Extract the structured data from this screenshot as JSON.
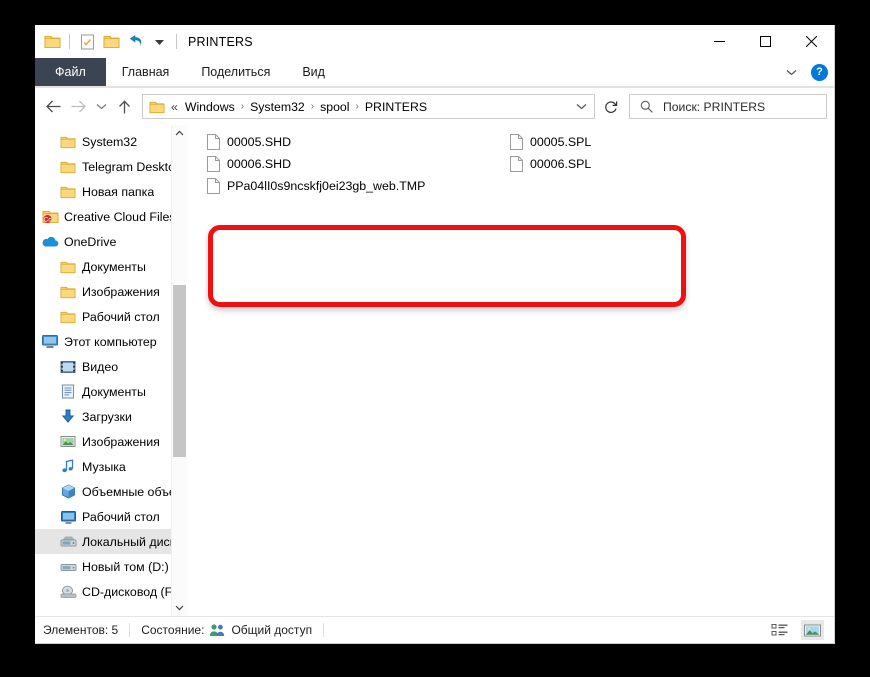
{
  "window": {
    "title": "PRINTERS",
    "quick_access": [
      {
        "name": "folder-icon",
        "label": "Папка"
      },
      {
        "name": "properties-icon",
        "label": "Свойства"
      },
      {
        "name": "new-folder-icon",
        "label": "Создать папку"
      },
      {
        "name": "undo-icon",
        "label": "Отменить"
      },
      {
        "name": "customize-dropdown-icon",
        "label": "Настроить панель быстрого доступа"
      }
    ],
    "controls": {
      "minimize": "—",
      "maximize": "☐",
      "close": "✕"
    }
  },
  "ribbon": {
    "tabs": [
      {
        "label": "Файл",
        "active": true
      },
      {
        "label": "Главная",
        "active": false
      },
      {
        "label": "Поделиться",
        "active": false
      },
      {
        "label": "Вид",
        "active": false
      }
    ],
    "expand_label": "⌄",
    "help_label": "?"
  },
  "navigation": {
    "back_label": "←",
    "forward_label": "→",
    "recent_label": "⌄",
    "up_label": "↑",
    "refresh_label": "↻",
    "dropdown_label": "⌄"
  },
  "address": {
    "prefix": "«",
    "crumbs": [
      "Windows",
      "System32",
      "spool",
      "PRINTERS"
    ],
    "separator": "›"
  },
  "search": {
    "placeholder": "Поиск: PRINTERS",
    "value": "Поиск: PRINTERS",
    "icon": "search-icon"
  },
  "sidebar": {
    "items": [
      {
        "label": "System32",
        "icon": "folder-icon",
        "indent": 1,
        "selected": false
      },
      {
        "label": "Telegram Desktop",
        "icon": "folder-icon",
        "indent": 1,
        "selected": false
      },
      {
        "label": "Новая папка",
        "icon": "folder-icon",
        "indent": 1,
        "selected": false
      },
      {
        "label": "Creative Cloud Files",
        "icon": "creative-cloud-icon",
        "indent": 0,
        "selected": false
      },
      {
        "label": "OneDrive",
        "icon": "onedrive-cloud-icon",
        "indent": 0,
        "selected": false
      },
      {
        "label": "Документы",
        "icon": "folder-icon",
        "indent": 1,
        "selected": false
      },
      {
        "label": "Изображения",
        "icon": "folder-icon",
        "indent": 1,
        "selected": false
      },
      {
        "label": "Рабочий стол",
        "icon": "folder-icon",
        "indent": 1,
        "selected": false
      },
      {
        "label": "Этот компьютер",
        "icon": "this-pc-icon",
        "indent": 0,
        "selected": false
      },
      {
        "label": "Видео",
        "icon": "video-icon",
        "indent": 1,
        "selected": false
      },
      {
        "label": "Документы",
        "icon": "documents-icon",
        "indent": 1,
        "selected": false
      },
      {
        "label": "Загрузки",
        "icon": "downloads-icon",
        "indent": 1,
        "selected": false
      },
      {
        "label": "Изображения",
        "icon": "pictures-icon",
        "indent": 1,
        "selected": false
      },
      {
        "label": "Музыка",
        "icon": "music-icon",
        "indent": 1,
        "selected": false
      },
      {
        "label": "Объемные объек",
        "icon": "3d-objects-icon",
        "indent": 1,
        "selected": false
      },
      {
        "label": "Рабочий стол",
        "icon": "desktop-icon",
        "indent": 1,
        "selected": false
      },
      {
        "label": "Локальный диск (",
        "icon": "local-disk-icon",
        "indent": 1,
        "selected": true
      },
      {
        "label": "Новый том (D:)",
        "icon": "drive-icon",
        "indent": 1,
        "selected": false
      },
      {
        "label": "CD-дисковод (F:)",
        "icon": "cd-drive-icon",
        "indent": 1,
        "selected": false
      }
    ]
  },
  "files": {
    "column1": [
      {
        "name": "00005.SHD",
        "icon": "file-icon"
      },
      {
        "name": "00006.SHD",
        "icon": "file-icon"
      },
      {
        "name": "PPa04lI0s9ncskfj0ei23gb_web.TMP",
        "icon": "file-icon"
      }
    ],
    "column2": [
      {
        "name": "00005.SPL",
        "icon": "file-icon"
      },
      {
        "name": "00006.SPL",
        "icon": "file-icon"
      }
    ]
  },
  "status": {
    "items_label": "Элементов: 5",
    "state_label": "Состояние:",
    "share_label": "Общий доступ",
    "share_icon": "shared-users-icon",
    "views": [
      {
        "name": "details-view-button",
        "active": false
      },
      {
        "name": "large-icons-view-button",
        "active": true
      }
    ]
  },
  "annotation": {
    "highlight_color": "#ee1111",
    "shape": "rounded-rectangle"
  }
}
